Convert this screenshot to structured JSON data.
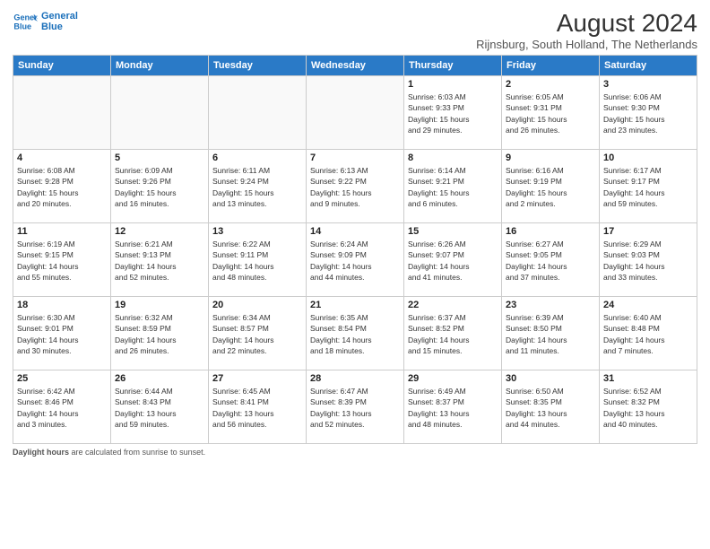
{
  "header": {
    "logo_line1": "General",
    "logo_line2": "Blue",
    "month_year": "August 2024",
    "location": "Rijnsburg, South Holland, The Netherlands"
  },
  "weekdays": [
    "Sunday",
    "Monday",
    "Tuesday",
    "Wednesday",
    "Thursday",
    "Friday",
    "Saturday"
  ],
  "weeks": [
    [
      {
        "day": "",
        "info": ""
      },
      {
        "day": "",
        "info": ""
      },
      {
        "day": "",
        "info": ""
      },
      {
        "day": "",
        "info": ""
      },
      {
        "day": "1",
        "info": "Sunrise: 6:03 AM\nSunset: 9:33 PM\nDaylight: 15 hours\nand 29 minutes."
      },
      {
        "day": "2",
        "info": "Sunrise: 6:05 AM\nSunset: 9:31 PM\nDaylight: 15 hours\nand 26 minutes."
      },
      {
        "day": "3",
        "info": "Sunrise: 6:06 AM\nSunset: 9:30 PM\nDaylight: 15 hours\nand 23 minutes."
      }
    ],
    [
      {
        "day": "4",
        "info": "Sunrise: 6:08 AM\nSunset: 9:28 PM\nDaylight: 15 hours\nand 20 minutes."
      },
      {
        "day": "5",
        "info": "Sunrise: 6:09 AM\nSunset: 9:26 PM\nDaylight: 15 hours\nand 16 minutes."
      },
      {
        "day": "6",
        "info": "Sunrise: 6:11 AM\nSunset: 9:24 PM\nDaylight: 15 hours\nand 13 minutes."
      },
      {
        "day": "7",
        "info": "Sunrise: 6:13 AM\nSunset: 9:22 PM\nDaylight: 15 hours\nand 9 minutes."
      },
      {
        "day": "8",
        "info": "Sunrise: 6:14 AM\nSunset: 9:21 PM\nDaylight: 15 hours\nand 6 minutes."
      },
      {
        "day": "9",
        "info": "Sunrise: 6:16 AM\nSunset: 9:19 PM\nDaylight: 15 hours\nand 2 minutes."
      },
      {
        "day": "10",
        "info": "Sunrise: 6:17 AM\nSunset: 9:17 PM\nDaylight: 14 hours\nand 59 minutes."
      }
    ],
    [
      {
        "day": "11",
        "info": "Sunrise: 6:19 AM\nSunset: 9:15 PM\nDaylight: 14 hours\nand 55 minutes."
      },
      {
        "day": "12",
        "info": "Sunrise: 6:21 AM\nSunset: 9:13 PM\nDaylight: 14 hours\nand 52 minutes."
      },
      {
        "day": "13",
        "info": "Sunrise: 6:22 AM\nSunset: 9:11 PM\nDaylight: 14 hours\nand 48 minutes."
      },
      {
        "day": "14",
        "info": "Sunrise: 6:24 AM\nSunset: 9:09 PM\nDaylight: 14 hours\nand 44 minutes."
      },
      {
        "day": "15",
        "info": "Sunrise: 6:26 AM\nSunset: 9:07 PM\nDaylight: 14 hours\nand 41 minutes."
      },
      {
        "day": "16",
        "info": "Sunrise: 6:27 AM\nSunset: 9:05 PM\nDaylight: 14 hours\nand 37 minutes."
      },
      {
        "day": "17",
        "info": "Sunrise: 6:29 AM\nSunset: 9:03 PM\nDaylight: 14 hours\nand 33 minutes."
      }
    ],
    [
      {
        "day": "18",
        "info": "Sunrise: 6:30 AM\nSunset: 9:01 PM\nDaylight: 14 hours\nand 30 minutes."
      },
      {
        "day": "19",
        "info": "Sunrise: 6:32 AM\nSunset: 8:59 PM\nDaylight: 14 hours\nand 26 minutes."
      },
      {
        "day": "20",
        "info": "Sunrise: 6:34 AM\nSunset: 8:57 PM\nDaylight: 14 hours\nand 22 minutes."
      },
      {
        "day": "21",
        "info": "Sunrise: 6:35 AM\nSunset: 8:54 PM\nDaylight: 14 hours\nand 18 minutes."
      },
      {
        "day": "22",
        "info": "Sunrise: 6:37 AM\nSunset: 8:52 PM\nDaylight: 14 hours\nand 15 minutes."
      },
      {
        "day": "23",
        "info": "Sunrise: 6:39 AM\nSunset: 8:50 PM\nDaylight: 14 hours\nand 11 minutes."
      },
      {
        "day": "24",
        "info": "Sunrise: 6:40 AM\nSunset: 8:48 PM\nDaylight: 14 hours\nand 7 minutes."
      }
    ],
    [
      {
        "day": "25",
        "info": "Sunrise: 6:42 AM\nSunset: 8:46 PM\nDaylight: 14 hours\nand 3 minutes."
      },
      {
        "day": "26",
        "info": "Sunrise: 6:44 AM\nSunset: 8:43 PM\nDaylight: 13 hours\nand 59 minutes."
      },
      {
        "day": "27",
        "info": "Sunrise: 6:45 AM\nSunset: 8:41 PM\nDaylight: 13 hours\nand 56 minutes."
      },
      {
        "day": "28",
        "info": "Sunrise: 6:47 AM\nSunset: 8:39 PM\nDaylight: 13 hours\nand 52 minutes."
      },
      {
        "day": "29",
        "info": "Sunrise: 6:49 AM\nSunset: 8:37 PM\nDaylight: 13 hours\nand 48 minutes."
      },
      {
        "day": "30",
        "info": "Sunrise: 6:50 AM\nSunset: 8:35 PM\nDaylight: 13 hours\nand 44 minutes."
      },
      {
        "day": "31",
        "info": "Sunrise: 6:52 AM\nSunset: 8:32 PM\nDaylight: 13 hours\nand 40 minutes."
      }
    ]
  ],
  "footer": {
    "label": "Daylight hours",
    "text": " are calculated from sunrise to sunset."
  }
}
